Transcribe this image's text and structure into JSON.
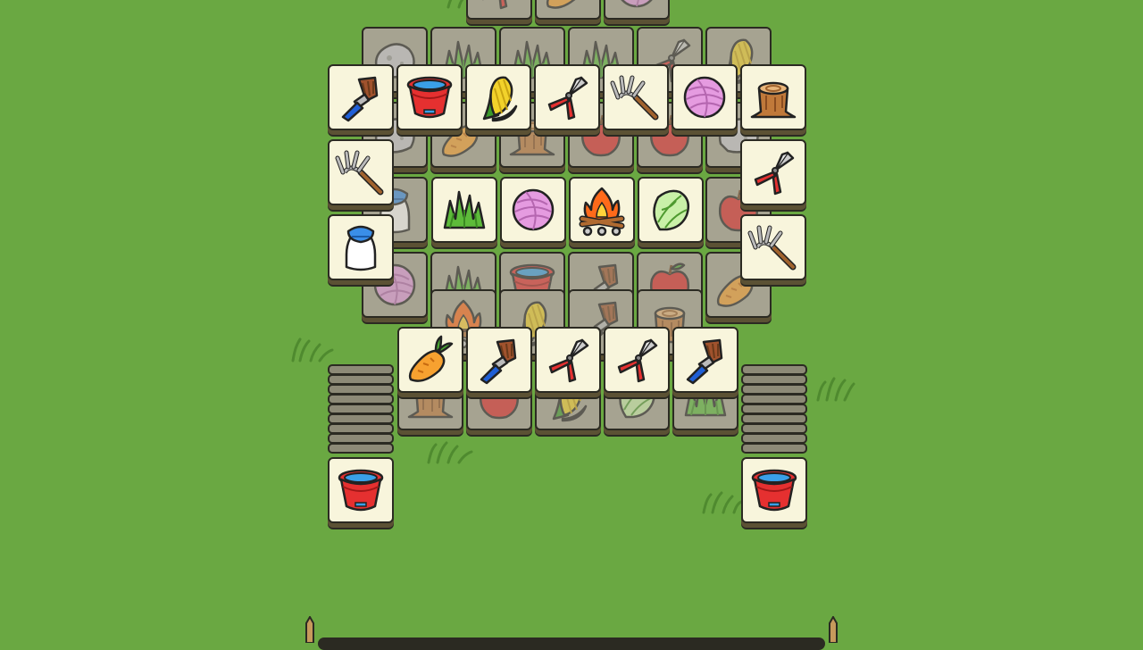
{
  "game": {
    "title": "",
    "colors": {
      "background": "#6aa842",
      "tile_face": "#f8f5dc",
      "tile_locked": "#a6a391",
      "tile_edge": "#2b2a22"
    },
    "icon_names": [
      "brush-icon",
      "bucket-icon",
      "corn-icon",
      "pruner-icon",
      "rake-icon",
      "yarn-icon",
      "stump-icon",
      "grass-icon",
      "campfire-icon",
      "lettuce-icon",
      "milk-bottle-icon",
      "carrot-icon",
      "apple-icon",
      "rock-icon"
    ],
    "top_layer_tiles": [
      {
        "icon": "brush-icon",
        "free": true
      },
      {
        "icon": "bucket-icon",
        "free": true
      },
      {
        "icon": "corn-icon",
        "free": true
      },
      {
        "icon": "pruner-icon",
        "free": true
      },
      {
        "icon": "rake-icon",
        "free": true
      },
      {
        "icon": "yarn-icon",
        "free": true
      },
      {
        "icon": "stump-icon",
        "free": true
      },
      {
        "icon": "rake-icon",
        "free": true
      },
      {
        "icon": "pruner-icon",
        "free": true
      },
      {
        "icon": "grass-icon",
        "free": true
      },
      {
        "icon": "yarn-icon",
        "free": true
      },
      {
        "icon": "campfire-icon",
        "free": true
      },
      {
        "icon": "lettuce-icon",
        "free": true
      },
      {
        "icon": "milk-bottle-icon",
        "free": true
      },
      {
        "icon": "rake-icon",
        "free": true
      },
      {
        "icon": "carrot-icon",
        "free": true
      },
      {
        "icon": "brush-icon",
        "free": true
      },
      {
        "icon": "pruner-icon",
        "free": true
      },
      {
        "icon": "pruner-icon",
        "free": true
      },
      {
        "icon": "brush-icon",
        "free": true
      },
      {
        "icon": "bucket-icon",
        "free": true
      },
      {
        "icon": "bucket-icon",
        "free": true
      }
    ],
    "side_stacks": [
      {
        "side": "left",
        "count": 9
      },
      {
        "side": "right",
        "count": 9
      }
    ]
  }
}
